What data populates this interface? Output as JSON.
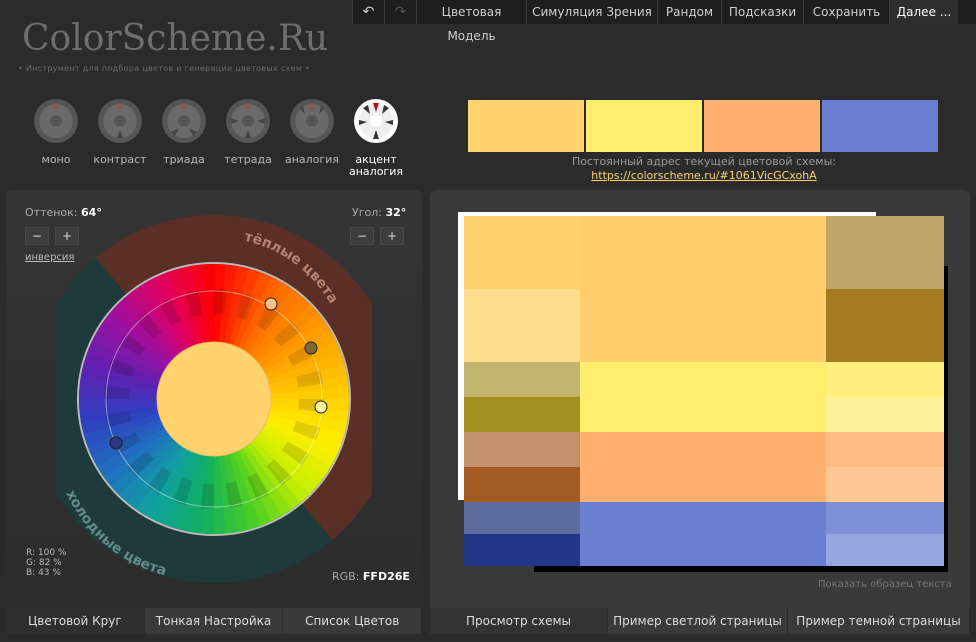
{
  "nav": {
    "undo_icon": "undo-icon",
    "redo_icon": "redo-icon",
    "items": [
      "Цветовая Модель",
      "Симуляция Зрения",
      "Рандом",
      "Подсказки",
      "Сохранить",
      "Далее ..."
    ]
  },
  "logo": "ColorScheme.Ru",
  "tagline": "• Инструмент для подбора цветов и генерации цветовых схем •",
  "schemes": [
    {
      "label": "моно",
      "active": false
    },
    {
      "label": "контраст",
      "active": false
    },
    {
      "label": "триада",
      "active": false
    },
    {
      "label": "тетрада",
      "active": false
    },
    {
      "label": "аналогия",
      "active": false
    },
    {
      "label": "акцент аналогия",
      "active": true
    }
  ],
  "palette": [
    "#ffd26e",
    "#ffed6e",
    "#ffb06e",
    "#6a7fcf"
  ],
  "permalink": {
    "label": "Постоянный адрес текущей цветовой схемы:",
    "url": "https://colorscheme.ru/#1061VicGCxohA"
  },
  "controls": {
    "hue_label": "Оттенок:",
    "hue_value": "64°",
    "angle_label": "Угол:",
    "angle_value": "32°",
    "minus": "−",
    "plus": "+",
    "inverse": "инверсия"
  },
  "wheel": {
    "warm_label": "тёплые цвета",
    "cold_label": "холодные цвета",
    "center_color": "#ffd26e"
  },
  "rgb": {
    "r": "R: 100 %",
    "g": "G:   82 %",
    "b": "B:   43 %",
    "hex_label": "RGB:",
    "hex_value": "FFD26E"
  },
  "left_tabs": [
    "Цветовой Круг",
    "Тонкая Настройка",
    "Список Цветов"
  ],
  "right_tabs": [
    "Просмотр схемы",
    "Пример светлой страницы",
    "Пример темной страницы"
  ],
  "show_sample": "Показать образец текста",
  "colors": {
    "primary": [
      "#ffd26e",
      "#ffdd8e",
      "#ffce6a",
      "#c1a56b",
      "#a37a1f"
    ],
    "secondary1": [
      "#c2b46a",
      "#a68f21",
      "#ffed6e",
      "#ffef7e",
      "#fff09a"
    ],
    "secondary2": [
      "#c3916c",
      "#a55c22",
      "#ffb06e",
      "#ffbc82",
      "#ffc794"
    ],
    "complement": [
      "#5d6c9f",
      "#203788",
      "#6a7fcf",
      "#7f91d6",
      "#96a6e0"
    ]
  }
}
